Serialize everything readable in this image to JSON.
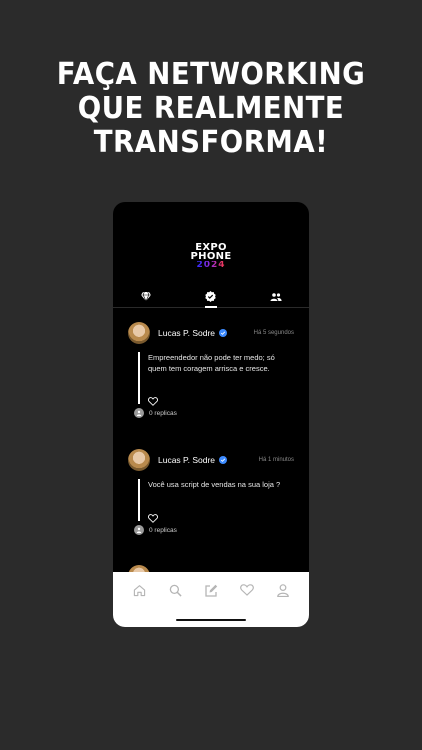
{
  "headline": {
    "line1": "FAÇA NETWORKING",
    "line2": "QUE REALMENTE",
    "line3": "TRANSFORMA!"
  },
  "logo": {
    "line1": "EXPO",
    "line2": "PHONE",
    "line3": "2024"
  },
  "tabs": [
    {
      "icon": "diamond-icon",
      "active": false
    },
    {
      "icon": "verified-badge-icon",
      "active": true
    },
    {
      "icon": "people-icon",
      "active": false
    }
  ],
  "posts": [
    {
      "author": "Lucas P. Sodre",
      "time": "Há 5 segundos",
      "text": "Empreendedor não pode ter medo; só quem tem coragem arrisca e cresce.",
      "replies": "0 replicas"
    },
    {
      "author": "Lucas P. Sodre",
      "time": "Há 1 minutos",
      "text": "Você usa script de vendas na sua loja ?",
      "replies": "0 replicas"
    }
  ],
  "bottom_nav": [
    "home-icon",
    "search-icon",
    "compose-icon",
    "heart-icon",
    "profile-icon"
  ],
  "colors": {
    "background": "#2b2b2b",
    "phone": "#000000",
    "verified": "#3d8bff",
    "nav_bar": "#ffffff"
  }
}
